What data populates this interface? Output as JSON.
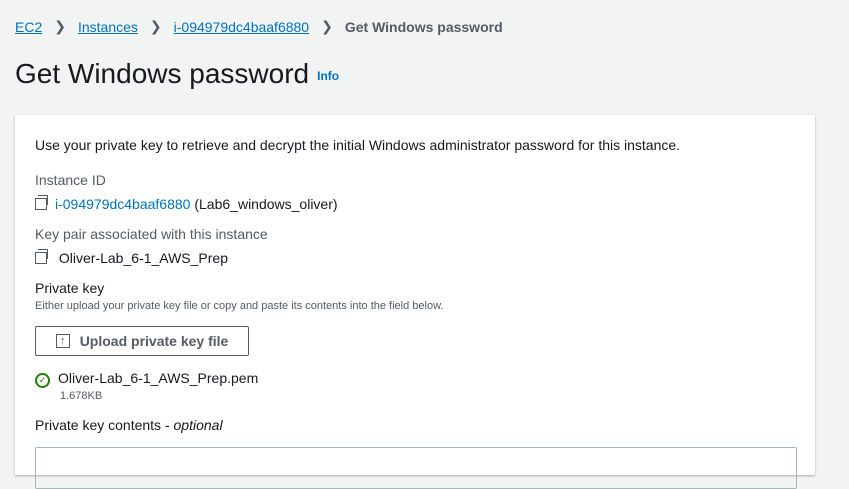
{
  "breadcrumb": [
    {
      "label": "EC2"
    },
    {
      "label": "Instances"
    },
    {
      "label": "i-094979dc4baaf6880"
    },
    {
      "label": "Get Windows password"
    }
  ],
  "page": {
    "title": "Get Windows password",
    "info": "Info"
  },
  "card": {
    "description": "Use your private key to retrieve and decrypt the initial Windows administrator password for this instance.",
    "instance_id_label": "Instance ID",
    "instance_id": "i-094979dc4baaf6880",
    "instance_name": "(Lab6_windows_oliver)",
    "key_pair_label": "Key pair associated with this instance",
    "key_pair": "Oliver-Lab_6-1_AWS_Prep",
    "private_key_label": "Private key",
    "private_key_hint": "Either upload your private key file or copy and paste its contents into the field below.",
    "upload_button": "Upload private key file",
    "file_name": "Oliver-Lab_6-1_AWS_Prep.pem",
    "file_size": "1.678KB",
    "contents_label": "Private key contents - ",
    "contents_optional": "optional",
    "contents_value": ""
  }
}
